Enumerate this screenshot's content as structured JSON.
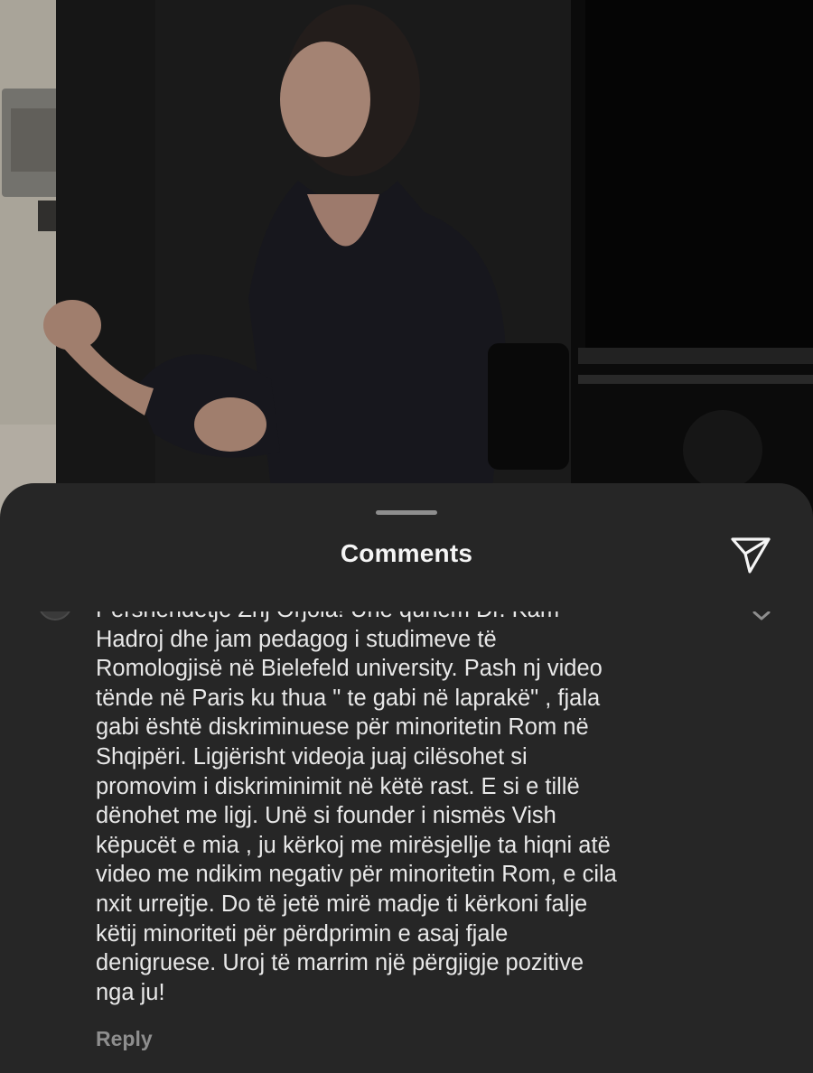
{
  "sheet": {
    "title": "Comments",
    "share_icon": "paper-plane-icon"
  },
  "comment": {
    "avatar_icon": "avatar",
    "text": "Pershendetje Znj Orjola! Unë quhem Dr. Kam\nHadroj dhe jam pedagog i studimeve të\nRomologjisë në Bielefeld university. Pash nj video\ntënde në Paris ku thua \" te gabi në laprakë\" , fjala\ngabi është diskriminuese për minoritetin Rom në\nShqipëri. Ligjërisht videoja juaj cilësohet si\npromovim i diskriminimit në këtë rast. E si e tillë\ndënohet me ligj. Unë si founder i nismës Vish\nkëpucët e mia , ju kërkoj me mirësjellje ta hiqni atë\nvideo me ndikim negativ për minoritetin Rom, e cila\nnxit urrejtje. Do të jetë mirë madje ti kërkoni falje\nkëtij minoriteti për përdprimin e asaj fjale\ndenigruese. Uroj të marrim një përgjigje pozitive\nnga ju!",
    "reply_label": "Reply",
    "collapse_icon": "chevron-down-icon"
  },
  "colors": {
    "sheet_background": "#262626",
    "text_primary": "#e8e8e8",
    "text_secondary": "#8e8e8e"
  }
}
